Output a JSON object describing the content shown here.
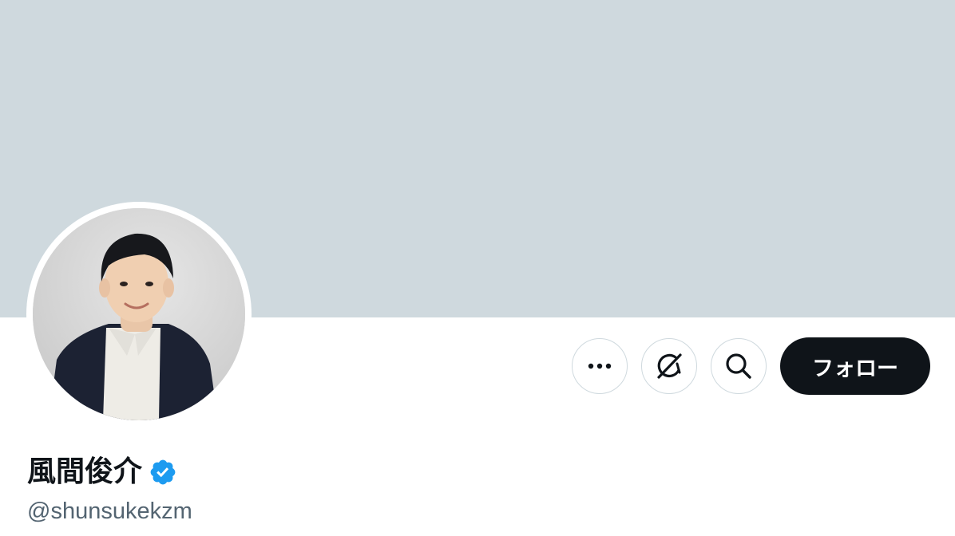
{
  "profile": {
    "display_name": "風間俊介",
    "handle": "@shunsukekzm",
    "verified": true,
    "avatar_icon": "profile-photo"
  },
  "actions": {
    "more_icon": "ellipsis-icon",
    "grok_icon": "grok-icon",
    "search_icon": "search-icon",
    "follow_label": "フォロー"
  },
  "colors": {
    "banner": "#cfd9de",
    "follow_button_bg": "#0f1419",
    "follow_button_text": "#ffffff",
    "name_text": "#0f1419",
    "handle_text": "#536471",
    "verified_badge": "#1d9bf0",
    "button_border": "#cfd9de"
  }
}
